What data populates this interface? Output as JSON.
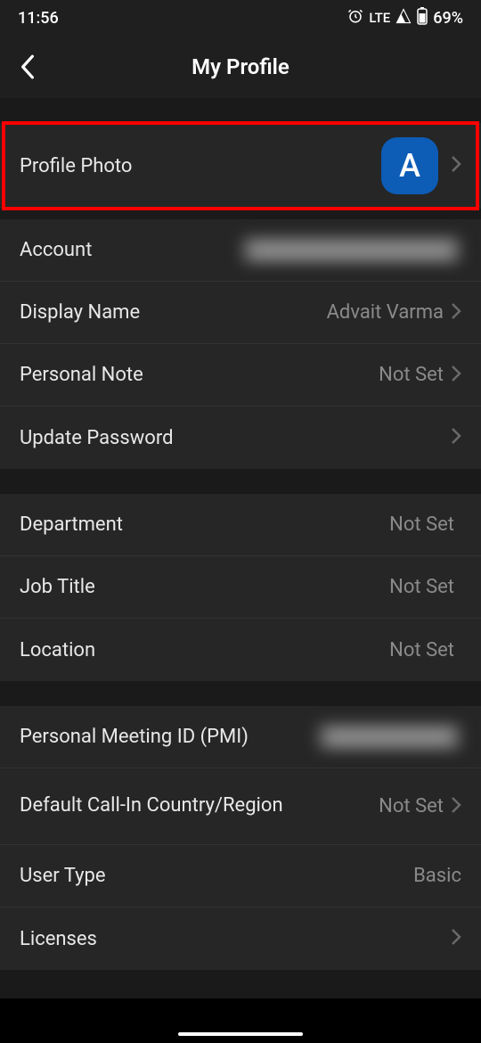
{
  "status": {
    "time": "11:56",
    "network": "LTE",
    "battery": "69%"
  },
  "header": {
    "title": "My Profile"
  },
  "rows": {
    "profile_photo": {
      "label": "Profile Photo",
      "avatar_initial": "A"
    },
    "account": {
      "label": "Account"
    },
    "display_name": {
      "label": "Display Name",
      "value": "Advait Varma"
    },
    "personal_note": {
      "label": "Personal Note",
      "value": "Not Set"
    },
    "update_password": {
      "label": "Update Password"
    },
    "department": {
      "label": "Department",
      "value": "Not Set"
    },
    "job_title": {
      "label": "Job Title",
      "value": "Not Set"
    },
    "location": {
      "label": "Location",
      "value": "Not Set"
    },
    "pmi": {
      "label": "Personal Meeting ID (PMI)"
    },
    "callin": {
      "label": "Default Call-In Country/Region",
      "value": "Not Set"
    },
    "user_type": {
      "label": "User Type",
      "value": "Basic"
    },
    "licenses": {
      "label": "Licenses"
    }
  }
}
